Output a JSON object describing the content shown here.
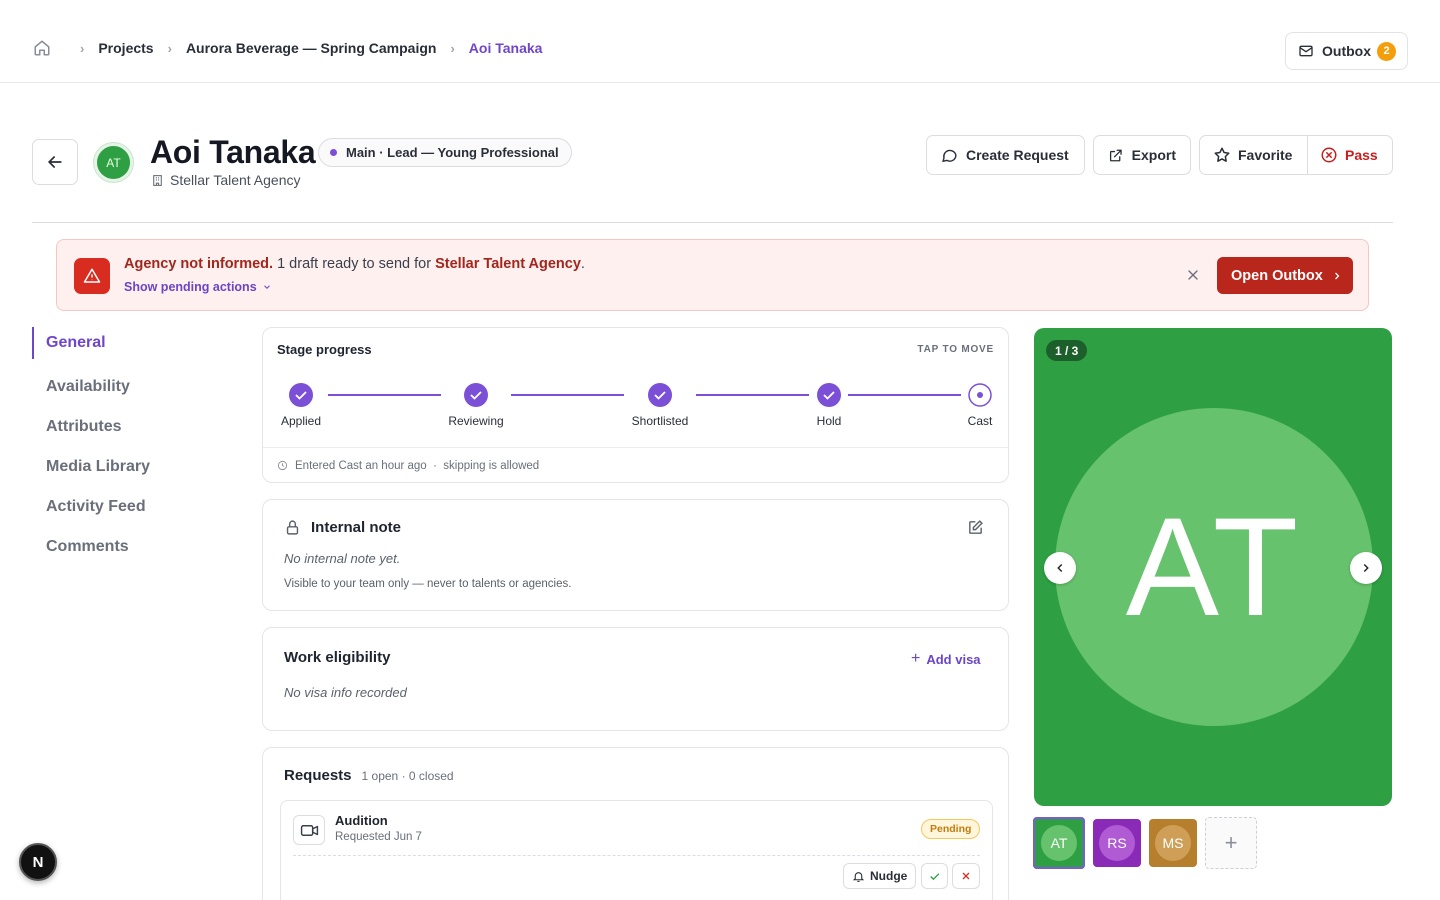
{
  "breadcrumb": {
    "items": [
      "Projects",
      "Aurora Beverage — Spring Campaign"
    ],
    "current": "Aoi Tanaka"
  },
  "outbox": {
    "label": "Outbox",
    "count": "2"
  },
  "talent": {
    "name": "Aoi Tanaka",
    "initials": "AT",
    "role": "Main · Lead — Young Professional",
    "agency": "Stellar Talent Agency"
  },
  "actions": {
    "create_request": "Create Request",
    "export": "Export",
    "favorite": "Favorite",
    "pass": "Pass"
  },
  "alert": {
    "strong": "Agency not informed.",
    "text": "1 draft ready to send for",
    "agency": "Stellar Talent Agency",
    "period": ".",
    "pending_link": "Show pending actions",
    "button": "Open Outbox"
  },
  "sidenav": {
    "items": [
      "General",
      "Availability",
      "Attributes",
      "Media Library",
      "Activity Feed",
      "Comments"
    ],
    "active": "General"
  },
  "stage": {
    "title": "Stage progress",
    "hint": "TAP TO MOVE",
    "steps": [
      {
        "label": "Applied",
        "state": "done"
      },
      {
        "label": "Reviewing",
        "state": "done"
      },
      {
        "label": "Shortlisted",
        "state": "done"
      },
      {
        "label": "Hold",
        "state": "done"
      },
      {
        "label": "Cast",
        "state": "current"
      }
    ],
    "footer": "Entered Cast an hour ago  ·  skipping is allowed"
  },
  "internal_note": {
    "title": "Internal note",
    "empty": "No internal note yet.",
    "visibility": "Visible to your team only — never to talents or agencies."
  },
  "work_eligibility": {
    "title": "Work eligibility",
    "add_label": "Add visa",
    "empty": "No visa info recorded"
  },
  "requests": {
    "title": "Requests",
    "summary": "1 open · 0 closed",
    "items": [
      {
        "name": "Audition",
        "date": "Requested Jun 7",
        "status": "Pending",
        "nudge": "Nudge"
      }
    ]
  },
  "media": {
    "counter": "1 / 3",
    "thumbs": [
      {
        "initials": "AT"
      },
      {
        "initials": "RS"
      },
      {
        "initials": "MS"
      }
    ],
    "add_symbol": "+"
  },
  "devtools": {
    "label": "N"
  },
  "colors": {
    "accent": "#7046c8",
    "danger": "#b9261b",
    "media_bg": "#2ea043",
    "pending": "#c27c0e"
  }
}
